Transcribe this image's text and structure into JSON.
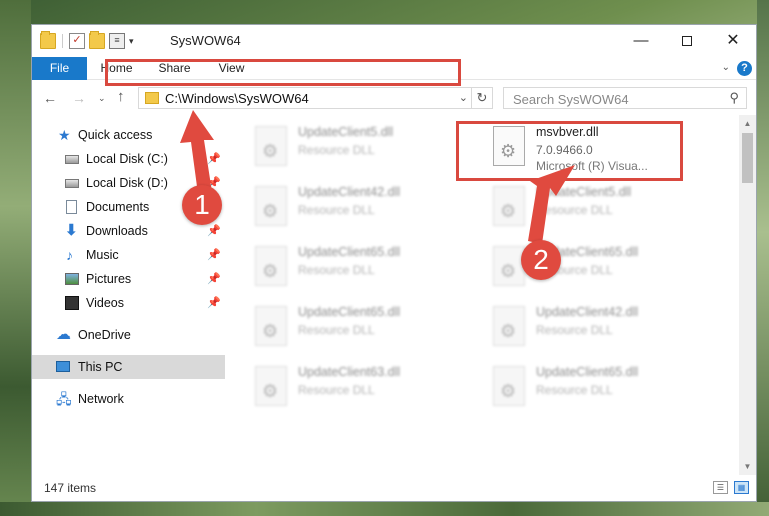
{
  "window": {
    "title": "SysWOW64",
    "minimize_glyph": "—",
    "close_glyph": "✕"
  },
  "ribbon": {
    "tabs": [
      {
        "label": "File"
      },
      {
        "label": "Home"
      },
      {
        "label": "Share"
      },
      {
        "label": "View"
      }
    ],
    "help_glyph": "?"
  },
  "nav": {
    "address": "C:\\Windows\\SysWOW64",
    "search_placeholder": "Search SysWOW64"
  },
  "sidebar": {
    "items": [
      {
        "label": "Quick access",
        "icon": "star-icon"
      },
      {
        "label": "Local Disk (C:)",
        "icon": "disk-icon",
        "pinned": true
      },
      {
        "label": "Local Disk (D:)",
        "icon": "disk-icon",
        "pinned": true
      },
      {
        "label": "Documents",
        "icon": "document-icon",
        "pinned": true
      },
      {
        "label": "Downloads",
        "icon": "download-icon",
        "pinned": true
      },
      {
        "label": "Music",
        "icon": "music-icon",
        "pinned": true
      },
      {
        "label": "Pictures",
        "icon": "pictures-icon",
        "pinned": true
      },
      {
        "label": "Videos",
        "icon": "videos-icon",
        "pinned": true
      },
      {
        "label": "OneDrive",
        "icon": "cloud-icon"
      },
      {
        "label": "This PC",
        "icon": "computer-icon",
        "selected": true
      },
      {
        "label": "Network",
        "icon": "network-icon"
      }
    ]
  },
  "files": {
    "left_column": [
      {
        "name": "UpdateClient5.dll",
        "desc": "Resource DLL"
      },
      {
        "name": "UpdateClient42.dll",
        "desc": "Resource DLL"
      },
      {
        "name": "UpdateClient65.dll",
        "desc": "Resource DLL"
      },
      {
        "name": "UpdateClient65.dll",
        "desc": "Resource DLL"
      },
      {
        "name": "UpdateClient63.dll",
        "desc": "Resource DLL"
      }
    ],
    "right_column": [
      {
        "name": "UpdateClient5.dll",
        "desc": "Resource DLL"
      },
      {
        "name": "UpdateClient65.dll",
        "desc": "Resource DLL"
      },
      {
        "name": "UpdateClient42.dll",
        "desc": "Resource DLL"
      },
      {
        "name": "UpdateClient65.dll",
        "desc": "Resource DLL"
      }
    ],
    "target": {
      "name": "msvbver.dll",
      "version": "7.0.9466.0",
      "company": "Microsoft (R) Visua..."
    }
  },
  "status": {
    "item_count": "147 items"
  },
  "callouts": {
    "first": "1",
    "second": "2"
  },
  "colors": {
    "accent": "#1979ca",
    "highlight": "#d9493f"
  }
}
